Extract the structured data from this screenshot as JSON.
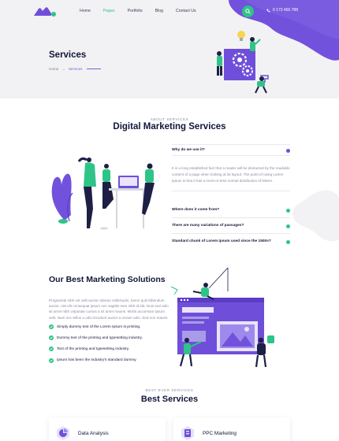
{
  "nav": {
    "items": [
      {
        "label": "Home",
        "active": false
      },
      {
        "label": "Pages",
        "active": true
      },
      {
        "label": "Portfolio",
        "active": false
      },
      {
        "label": "Blog",
        "active": false
      },
      {
        "label": "Contact Us",
        "active": false
      }
    ],
    "phone": "0 173 456 788"
  },
  "hero": {
    "title": "Services",
    "breadcrumb": {
      "home": "Home",
      "separator": "→",
      "current": "Services"
    }
  },
  "about": {
    "eyebrow": "ABOUT SERVICES",
    "title": "Digital Marketing Services",
    "faq": [
      {
        "question": "Why do we use it?",
        "answer": "It is a long established fact that a reader will be distracted by the readable content of a page when looking at its layout. The point of using Lorem Ipsum is that it has a more-or-less normal distribution of letters."
      },
      {
        "question": "Where does it come from?"
      },
      {
        "question": "There are many variations of passages?"
      },
      {
        "question": "Standard chunk of Lorem Ipsum used since the 1500s?"
      }
    ]
  },
  "solutions": {
    "title": "Our Best Marketing Solutions",
    "description": "Progravida nibh vel velit auctor alinean sollicitudin, lorem quis bibendum auctor, nisi elit consequat ipsum nec sagittis sem nibh id elit. Duis sed odio sit amet nibh vulputate cursus a sit amet mauris. Morbi accumsan ipsum velit. Nam nec tellus a odio tincidunt auctor a ornare odio. Sed non mauris vitae erat consequat auctor eu in elit. Class aptent taciti sociosqu ad litora torquent per conubia nostra, per inceptos himenaeos. Mauris in erat justo. Nullam ac urna eu felis dapibus condimentum sit amet a augue. Sed non neque elit. Sed ut imperdiet nisi. Proin condimentum fermentum nunc. Etiam pharetra, erat sed fermentum feugiat, velit mauris egestas quam, ut aliquam massa nisl quis neque. Suspendisse in orci enim.",
    "list": [
      "Simply dummy text of the Lorem Ipsum is printing.",
      "Dummy text of the printing and typesetting industry.",
      "Text of the printing and typesetting industry.",
      "Ipsum has been the industry's standard dummy."
    ]
  },
  "best_services": {
    "eyebrow": "BEST EVER SERVICES",
    "title": "Best Services",
    "cards": [
      {
        "label": "Data Analysis",
        "icon": "data-analysis-icon"
      },
      {
        "label": "PPC Marketing",
        "icon": "ppc-icon"
      }
    ]
  },
  "colors": {
    "accent": "#6f4fd9",
    "green": "#2ec488",
    "navy": "#12153a",
    "background": "#f2f2f4"
  }
}
